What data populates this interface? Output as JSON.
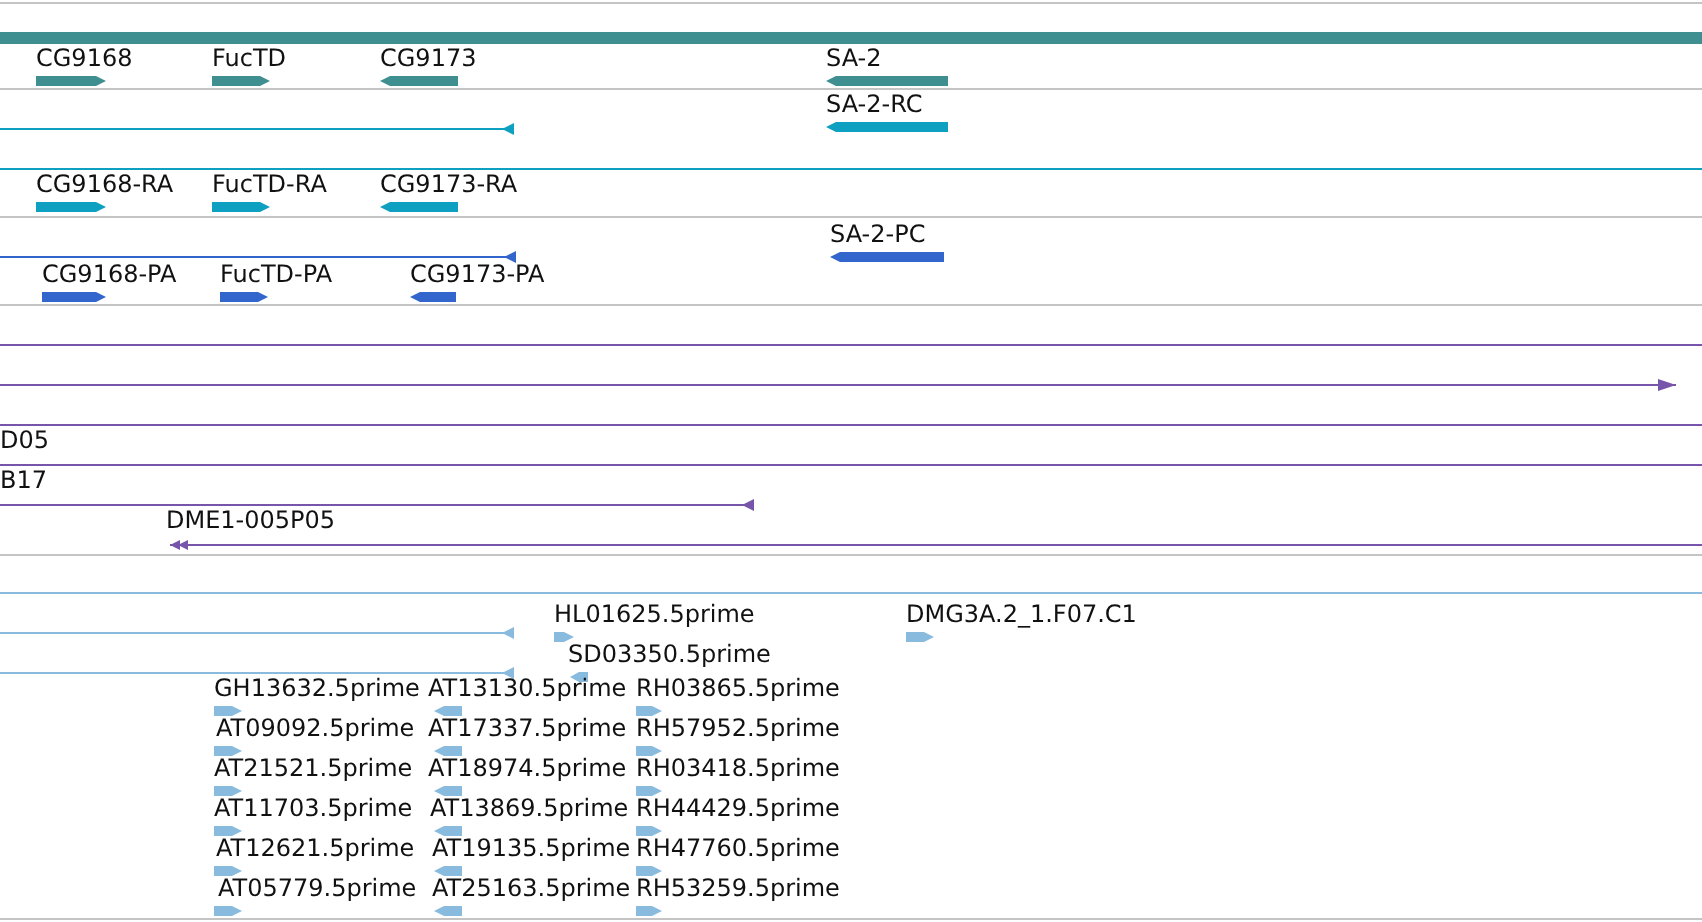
{
  "tracks": [
    {
      "color": "#3f8f91",
      "features": [
        {
          "kind": "bar"
        },
        {
          "kind": "block",
          "label": "CG9168",
          "reverse": false
        },
        {
          "kind": "block",
          "label": "FucTD",
          "reverse": false
        },
        {
          "kind": "block",
          "label": "CG9173",
          "reverse": true
        },
        {
          "kind": "block",
          "label": "SA-2",
          "reverse": true
        }
      ]
    },
    {
      "color": "#0ea0c0",
      "features": [
        {
          "kind": "line",
          "reverse": true
        },
        {
          "kind": "block",
          "label": "SA-2-RC",
          "reverse": true
        },
        {
          "kind": "line"
        },
        {
          "kind": "block",
          "label": "CG9168-RA",
          "reverse": false
        },
        {
          "kind": "block",
          "label": "FucTD-RA",
          "reverse": false
        },
        {
          "kind": "block",
          "label": "CG9173-RA",
          "reverse": true
        }
      ]
    },
    {
      "color": "#3366cc",
      "features": [
        {
          "kind": "block",
          "label": "SA-2-PC",
          "reverse": true
        },
        {
          "kind": "line",
          "reverse": true
        },
        {
          "kind": "block",
          "label": "CG9168-PA",
          "reverse": false
        },
        {
          "kind": "block",
          "label": "FucTD-PA",
          "reverse": false
        },
        {
          "kind": "block",
          "label": "CG9173-PA",
          "reverse": true
        }
      ]
    },
    {
      "color": "#7755aa",
      "features": [
        {
          "kind": "line"
        },
        {
          "kind": "line",
          "reverse": false
        },
        {
          "kind": "line"
        },
        {
          "kind": "line",
          "label": "D05"
        },
        {
          "kind": "line",
          "label": "B17",
          "reverse": true
        },
        {
          "kind": "line",
          "label": "DME1-005P05",
          "reverse": true
        }
      ]
    },
    {
      "color": "#88bbdd",
      "features": [
        {
          "kind": "line"
        },
        {
          "kind": "line",
          "reverse": true
        },
        {
          "kind": "block",
          "label": "HL01625.5prime",
          "reverse": false
        },
        {
          "kind": "block",
          "label": "DMG3A.2_1.F07.C1",
          "reverse": false
        },
        {
          "kind": "line",
          "reverse": true
        },
        {
          "kind": "block",
          "label": "SD03350.5prime",
          "reverse": true
        },
        {
          "kind": "block",
          "label": "GH13632.5prime",
          "reverse": false
        },
        {
          "kind": "block",
          "label": "AT13130.5prime",
          "reverse": true
        },
        {
          "kind": "block",
          "label": "RH03865.5prime",
          "reverse": false
        },
        {
          "kind": "block",
          "label": "AT09092.5prime",
          "reverse": false
        },
        {
          "kind": "block",
          "label": "AT17337.5prime",
          "reverse": true
        },
        {
          "kind": "block",
          "label": "RH57952.5prime",
          "reverse": false
        },
        {
          "kind": "block",
          "label": "AT21521.5prime",
          "reverse": false
        },
        {
          "kind": "block",
          "label": "AT18974.5prime",
          "reverse": true
        },
        {
          "kind": "block",
          "label": "RH03418.5prime",
          "reverse": false
        },
        {
          "kind": "block",
          "label": "AT11703.5prime",
          "reverse": false
        },
        {
          "kind": "block",
          "label": "AT13869.5prime",
          "reverse": true
        },
        {
          "kind": "block",
          "label": "RH44429.5prime",
          "reverse": false
        },
        {
          "kind": "block",
          "label": "AT12621.5prime",
          "reverse": false
        },
        {
          "kind": "block",
          "label": "AT19135.5prime",
          "reverse": true
        },
        {
          "kind": "block",
          "label": "RH47760.5prime",
          "reverse": false
        },
        {
          "kind": "block",
          "label": "AT05779.5prime",
          "reverse": false
        },
        {
          "kind": "block",
          "label": "AT25163.5prime",
          "reverse": true
        },
        {
          "kind": "block",
          "label": "RH53259.5prime",
          "reverse": false
        }
      ]
    }
  ]
}
